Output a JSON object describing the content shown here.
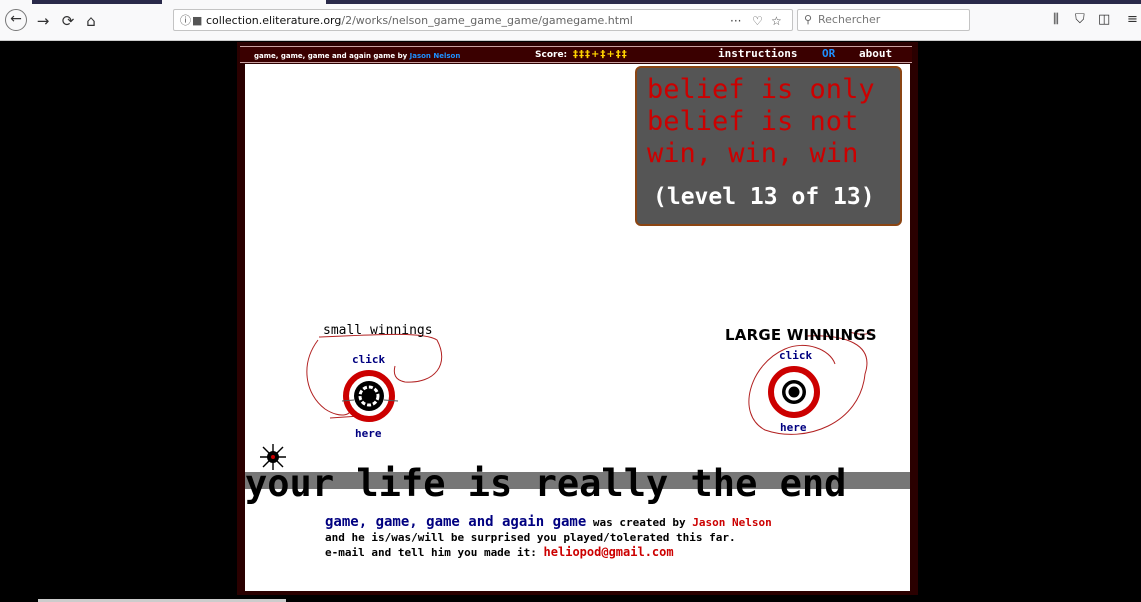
{
  "browser": {
    "url_domain": "collection.eliterature.org",
    "url_path": "/2/works/nelson_game_game_game/gamegame.html",
    "more_button": "···",
    "search_placeholder": "Rechercher",
    "icons": [
      "back-icon",
      "forward-icon",
      "reload-icon",
      "home-icon",
      "info-icon",
      "page-icon",
      "pocket-icon",
      "bookmark-star-icon",
      "search-icon",
      "library-icon",
      "shield-icon",
      "sidebar-icon",
      "menu-icon"
    ]
  },
  "game": {
    "title": "game, game, game and again game",
    "by": "by",
    "author": "Jason Nelson",
    "score_label": "Score:",
    "score_value": "‡‡‡+‡+‡‡",
    "nav_instructions": "instructions",
    "nav_or": "OR",
    "nav_about": "about",
    "belief_lines": [
      "belief is only",
      "belief is not",
      "win, win, win"
    ],
    "level": "(level 13 of 13)",
    "small_label": "small winnings",
    "large_label": "LARGE WINNINGS",
    "click": "click",
    "here": "here",
    "end_text": "your life is really the end",
    "credits": {
      "game_name": "game, game, game and again game",
      "created_by": "was created by",
      "author": "Jason Nelson",
      "line2": "and he is/was/will be surprised you played/tolerated this far.",
      "line3_prefix": "e-mail and tell him you made it:",
      "email": "heliopod@gmail.com"
    },
    "colors": {
      "frame": "#2a0000",
      "belief_box": "#555555",
      "belief_text": "#cc0000",
      "link_blue": "#000080",
      "score_yellow": "#ffd400"
    }
  }
}
